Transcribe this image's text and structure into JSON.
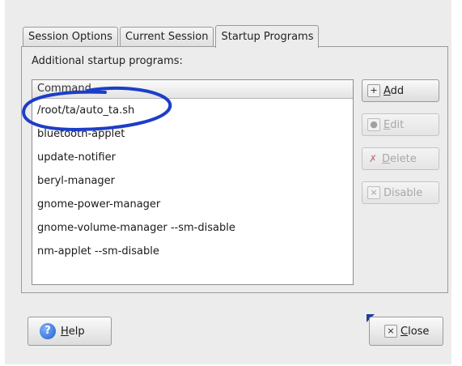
{
  "tabs": [
    {
      "label": "Session Options"
    },
    {
      "label": "Current Session"
    },
    {
      "label": "Startup Programs"
    }
  ],
  "section_label": "Additional startup programs:",
  "list": {
    "header": "Command",
    "rows": [
      "/root/ta/auto_ta.sh",
      "bluetooth-applet",
      "update-notifier",
      "beryl-manager",
      "gnome-power-manager",
      "gnome-volume-manager --sm-disable",
      "nm-applet --sm-disable"
    ]
  },
  "buttons": {
    "add": {
      "first": "A",
      "rest": "dd",
      "icon": "+"
    },
    "edit": {
      "first": "E",
      "rest": "dit"
    },
    "delete": {
      "first": "D",
      "rest": "elete"
    },
    "disable": {
      "label": "Disable"
    },
    "help": {
      "first": "H",
      "rest": "elp",
      "icon": "?"
    },
    "close": {
      "first": "C",
      "rest": "lose",
      "icon": "×"
    }
  },
  "colors": {
    "annotation": "#1c3ec8",
    "window_bg": "#ececec"
  }
}
